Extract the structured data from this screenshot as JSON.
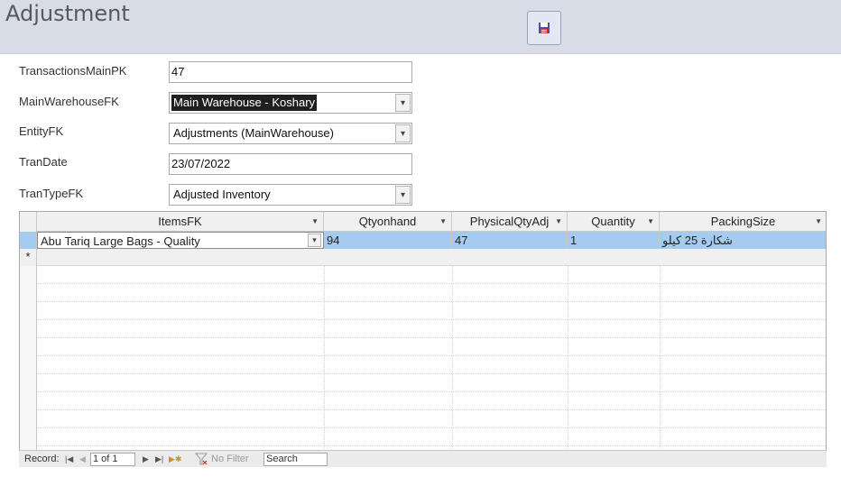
{
  "header": {
    "title": "Adjustment",
    "save_icon": "save-icon"
  },
  "form": {
    "transactions_main_pk": {
      "label": "TransactionsMainPK",
      "value": "47"
    },
    "main_warehouse_fk": {
      "label": "MainWarehouseFK",
      "value": "Main Warehouse - Koshary"
    },
    "entity_fk": {
      "label": "EntityFK",
      "value": "Adjustments (MainWarehouse)"
    },
    "tran_date": {
      "label": "TranDate",
      "value": "23/07/2022"
    },
    "tran_type_fk": {
      "label": "TranTypeFK",
      "value": "Adjusted Inventory"
    }
  },
  "grid": {
    "columns": [
      "ItemsFK",
      "Qtyonhand",
      "PhysicalQtyAdj",
      "Quantity",
      "PackingSize"
    ],
    "rows": [
      {
        "items_fk": "Abu Tariq Large Bags - Quality",
        "qty_on_hand": "94",
        "physical_qty_adj": "47",
        "quantity": "1",
        "packing_size": "شكارة 25 كيلو"
      }
    ],
    "new_row_marker": "*",
    "selected_row_color": "#a6cbf0"
  },
  "navigator": {
    "record_label": "Record:",
    "position": "1 of 1",
    "filter_label": "No Filter",
    "search_label": "Search"
  }
}
